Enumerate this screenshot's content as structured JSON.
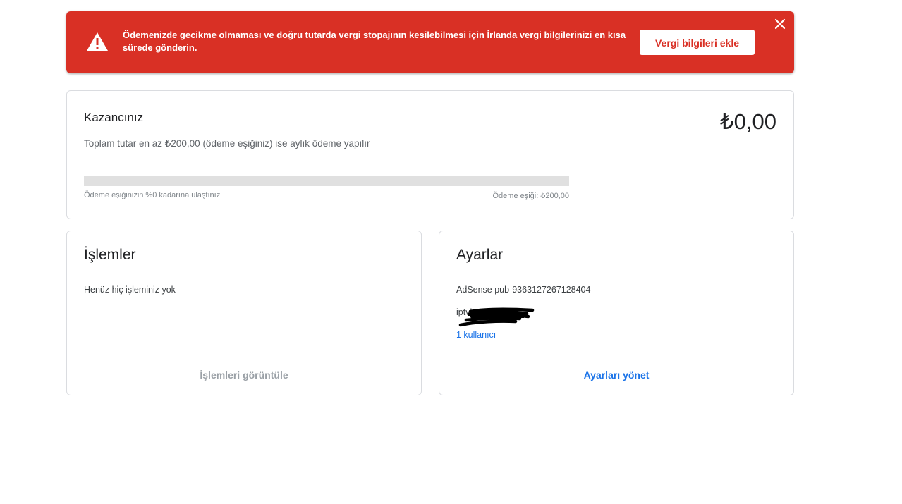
{
  "alert": {
    "message": "Ödemenizde gecikme olmaması ve doğru tutarda vergi stopajının kesilebilmesi için İrlanda vergi bilgilerinizi en kısa sürede gönderin.",
    "action_label": "Vergi bilgileri ekle",
    "background_color": "#d93025",
    "icon": "warning-triangle-icon"
  },
  "earnings": {
    "title": "Kazancınız",
    "subtitle": "Toplam tutar en az ₺200,00 (ödeme eşiğiniz) ise aylık ödeme yapılır",
    "amount": "₺0,00",
    "progress_fraction": 0,
    "progress_left_label": "Ödeme eşiğinizin %0 kadarına ulaştınız",
    "progress_right_label": "Ödeme eşiği: ₺200,00"
  },
  "transactions": {
    "title": "İşlemler",
    "empty_text": "Henüz hiç işleminiz yok",
    "footer_label": "İşlemleri görüntüle"
  },
  "settings": {
    "title": "Ayarlar",
    "publisher_line": "AdSense pub-9363127267128404",
    "account_name_visible": "iptvka",
    "users_link": "1 kullanıcı",
    "footer_label": "Ayarları yönet"
  }
}
